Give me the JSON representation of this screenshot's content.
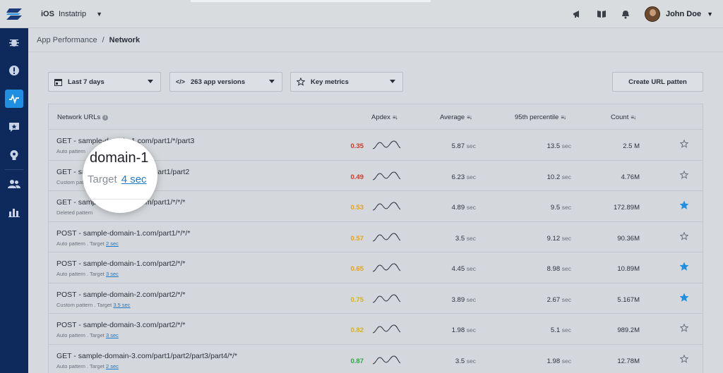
{
  "app": {
    "platform": "iOS",
    "name": "Instatrip"
  },
  "user": {
    "name": "John Doe"
  },
  "breadcrumb": {
    "parent": "App Performance",
    "separator": "/",
    "current": "Network"
  },
  "filters": {
    "date": "Last 7 days",
    "versions": "263 app versions",
    "metrics": "Key metrics",
    "create_button": "Create URL patten"
  },
  "table": {
    "headers": {
      "url": "Network URLs",
      "apdex": "Apdex",
      "average": "Average",
      "p95": "95th percentile",
      "count": "Count"
    },
    "unit": "sec",
    "target_label": "Target",
    "rows": [
      {
        "url": "GET - sample-domain-1.com/part1/*/part3",
        "pattern": "Auto pattern",
        "target": "",
        "apdex": "0.35",
        "apdex_color": "#d23a2a",
        "average": "5.87",
        "p95": "13.5",
        "count": "2.5 M",
        "starred": false
      },
      {
        "url": "GET - sample-domain-1.com/part1/part2",
        "pattern": "Custom pattern",
        "target": "4 sec",
        "apdex": "0.49",
        "apdex_color": "#d23a2a",
        "average": "6.23",
        "p95": "10.2",
        "count": "4.76M",
        "starred": false
      },
      {
        "url": "GET - sample-domain-1.com/part1/*/*/*",
        "pattern": "Deleted pattern",
        "target": "",
        "apdex": "0.53",
        "apdex_color": "#e6a21a",
        "average": "4.89",
        "p95": "9.5",
        "count": "172.89M",
        "starred": true
      },
      {
        "url": "POST - sample-domain-1.com/part1/*/*/*",
        "pattern": "Auto pattern",
        "target": "2 sec",
        "apdex": "0.57",
        "apdex_color": "#e6a21a",
        "average": "3.5",
        "p95": "9.12",
        "count": "90.36M",
        "starred": false
      },
      {
        "url": "POST - sample-domain-1.com/part2/*/*",
        "pattern": "Auto pattern",
        "target": "3 sec",
        "apdex": "0.65",
        "apdex_color": "#e6a21a",
        "average": "4.45",
        "p95": "8.98",
        "count": "10.89M",
        "starred": true
      },
      {
        "url": "POST - sample-domain-2.com/part2/*/*",
        "pattern": "Custom pattern",
        "target": "3.5 sec",
        "apdex": "0.75",
        "apdex_color": "#d4b417",
        "average": "3.89",
        "p95": "2.67",
        "count": "5.167M",
        "starred": true
      },
      {
        "url": "POST - sample-domain-3.com/part2/*/*",
        "pattern": "Auto pattern",
        "target": "3 sec",
        "apdex": "0.82",
        "apdex_color": "#d4b417",
        "average": "1.98",
        "p95": "5.1",
        "count": "989.2M",
        "starred": false
      },
      {
        "url": "GET - sample-domain-3.com/part1/part2/part3/part4/*/*",
        "pattern": "Auto pattern",
        "target": "2 sec",
        "apdex": "0.87",
        "apdex_color": "#2ea44f",
        "average": "3.5",
        "p95": "1.98",
        "count": "12.78M",
        "starred": false
      }
    ]
  },
  "magnifier": {
    "text": "domain-1",
    "target_label": "Target",
    "target_value": "4 sec"
  },
  "colors": {
    "sidebar": "#0e2a5c",
    "accent": "#1e8fe1",
    "star_active": "#1e8fe1"
  }
}
